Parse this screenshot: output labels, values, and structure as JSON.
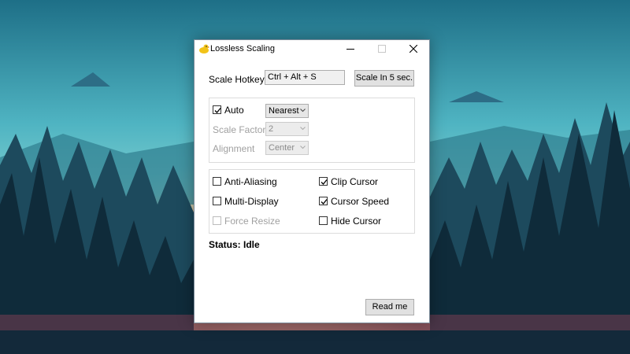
{
  "window": {
    "title": "Lossless Scaling",
    "controls": {
      "minimize": "minimize-icon",
      "maximize": "maximize-icon",
      "close": "close-icon"
    }
  },
  "hotkey": {
    "label": "Scale Hotkey",
    "value": "Ctrl + Alt + S",
    "scale_button": "Scale In 5 sec."
  },
  "scaling": {
    "auto_label": "Auto",
    "auto_checked": true,
    "mode_value": "Nearest",
    "scale_factor_label": "Scale Factor",
    "scale_factor_value": "2",
    "alignment_label": "Alignment",
    "alignment_value": "Center"
  },
  "options": {
    "anti_aliasing": {
      "label": "Anti-Aliasing",
      "checked": false
    },
    "multi_display": {
      "label": "Multi-Display",
      "checked": false
    },
    "force_resize": {
      "label": "Force Resize",
      "checked": false,
      "disabled": true
    },
    "clip_cursor": {
      "label": "Clip Cursor",
      "checked": true
    },
    "cursor_speed": {
      "label": "Cursor Speed",
      "checked": true
    },
    "hide_cursor": {
      "label": "Hide Cursor",
      "checked": false
    }
  },
  "status": {
    "text": "Status: Idle"
  },
  "footer": {
    "read_me": "Read me"
  },
  "colors": {
    "window_bg": "#ffffff",
    "button_bg": "#e1e1e1",
    "disabled_text": "#a0a0a0"
  }
}
